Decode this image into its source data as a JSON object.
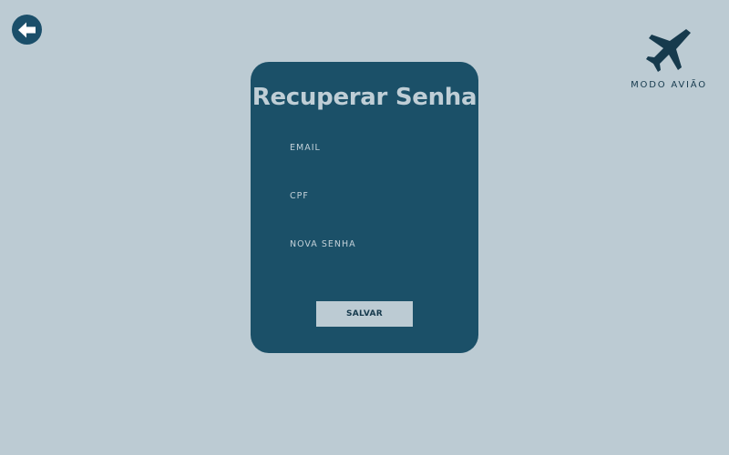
{
  "back": {
    "icon": "arrow-left-icon",
    "color": "#1b4f6a"
  },
  "logo": {
    "icon": "airplane-icon",
    "text": "MODO AVIÃO"
  },
  "card": {
    "title": "Recuperar Senha",
    "fields": [
      {
        "label": "EMAIL",
        "value": "",
        "placeholder": ""
      },
      {
        "label": "CPF",
        "value": "",
        "placeholder": ""
      },
      {
        "label": "NOVA SENHA",
        "value": "",
        "placeholder": ""
      }
    ],
    "save_label": "SALVAR"
  },
  "colors": {
    "background": "#bccbd3",
    "card": "#1b5068",
    "accent": "#163a4d"
  }
}
